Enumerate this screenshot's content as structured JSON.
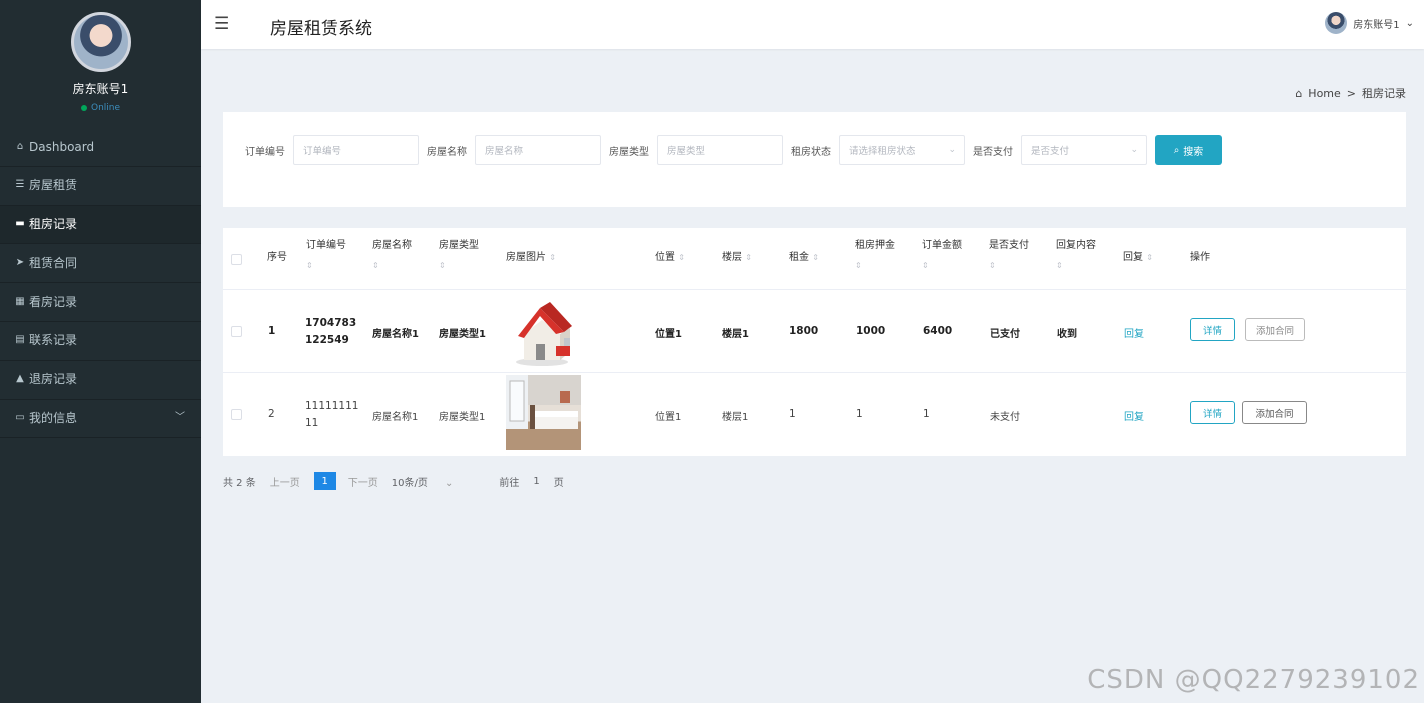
{
  "sidebar": {
    "profile_name": "房东账号1",
    "status": "Online",
    "items": [
      {
        "icon": "⌂",
        "icon_name": "home-icon",
        "label": "Dashboard",
        "active": false
      },
      {
        "icon": "☰",
        "icon_name": "list-icon",
        "label": "房屋租赁",
        "active": false
      },
      {
        "icon": "▬",
        "icon_name": "ticket-icon",
        "label": "租房记录",
        "active": true
      },
      {
        "icon": "➤",
        "icon_name": "send-icon",
        "label": "租赁合同",
        "active": false
      },
      {
        "icon": "▦",
        "icon_name": "grid-icon",
        "label": "看房记录",
        "active": false
      },
      {
        "icon": "▤",
        "icon_name": "lock-icon",
        "label": "联系记录",
        "active": false
      },
      {
        "icon": "▲",
        "icon_name": "user-icon",
        "label": "退房记录",
        "active": false
      },
      {
        "icon": "▭",
        "icon_name": "info-icon",
        "label": "我的信息",
        "active": false
      }
    ]
  },
  "header": {
    "title": "房屋租赁系统",
    "user": "房东账号1"
  },
  "breadcrumb": {
    "home": "Home",
    "separator": ">",
    "current": "租房记录"
  },
  "filters": {
    "order_no": {
      "label": "订单编号",
      "placeholder": "订单编号"
    },
    "house_name": {
      "label": "房屋名称",
      "placeholder": "房屋名称"
    },
    "house_type": {
      "label": "房屋类型",
      "placeholder": "房屋类型"
    },
    "rent_status": {
      "label": "租房状态",
      "placeholder": "请选择租房状态"
    },
    "paid": {
      "label": "是否支付",
      "placeholder": "是否支付"
    },
    "search_label": "搜索"
  },
  "table": {
    "headers": {
      "index": "序号",
      "order_no": "订单编号",
      "house_name": "房屋名称",
      "house_type": "房屋类型",
      "house_image": "房屋图片",
      "location": "位置",
      "floor": "楼层",
      "rent": "租金",
      "deposit": "租房押金",
      "order_amount": "订单金额",
      "paid": "是否支付",
      "reply_content": "回复内容",
      "reply": "回复",
      "actions": "操作"
    },
    "rows": [
      {
        "index": "1",
        "order_no_line1": "1704783",
        "order_no_line2": "122549",
        "house_name": "房屋名称1",
        "house_type": "房屋类型1",
        "location": "位置1",
        "floor": "楼层1",
        "rent": "1800",
        "deposit": "1000",
        "order_amount": "6400",
        "paid": "已支付",
        "reply_content": "收到",
        "reply": "回复",
        "detail": "详情",
        "contract": "添加合同"
      },
      {
        "index": "2",
        "order_no_line1": "11111111",
        "order_no_line2": "11",
        "house_name": "房屋名称1",
        "house_type": "房屋类型1",
        "location": "位置1",
        "floor": "楼层1",
        "rent": "1",
        "deposit": "1",
        "order_amount": "1",
        "paid": "未支付",
        "reply_content": "",
        "reply": "回复",
        "detail": "详情",
        "contract": "添加合同"
      }
    ]
  },
  "pagination": {
    "total": "共 2 条",
    "prev": "上一页",
    "current": "1",
    "next": "下一页",
    "page_size": "10条/页",
    "goto_label": "前往",
    "goto_value": "1",
    "page_unit": "页"
  },
  "watermark": "CSDN @QQ2279239102",
  "colors": {
    "sidebar_bg": "#222d32",
    "accent": "#22a5c3",
    "pager_active": "#1e88e5"
  }
}
